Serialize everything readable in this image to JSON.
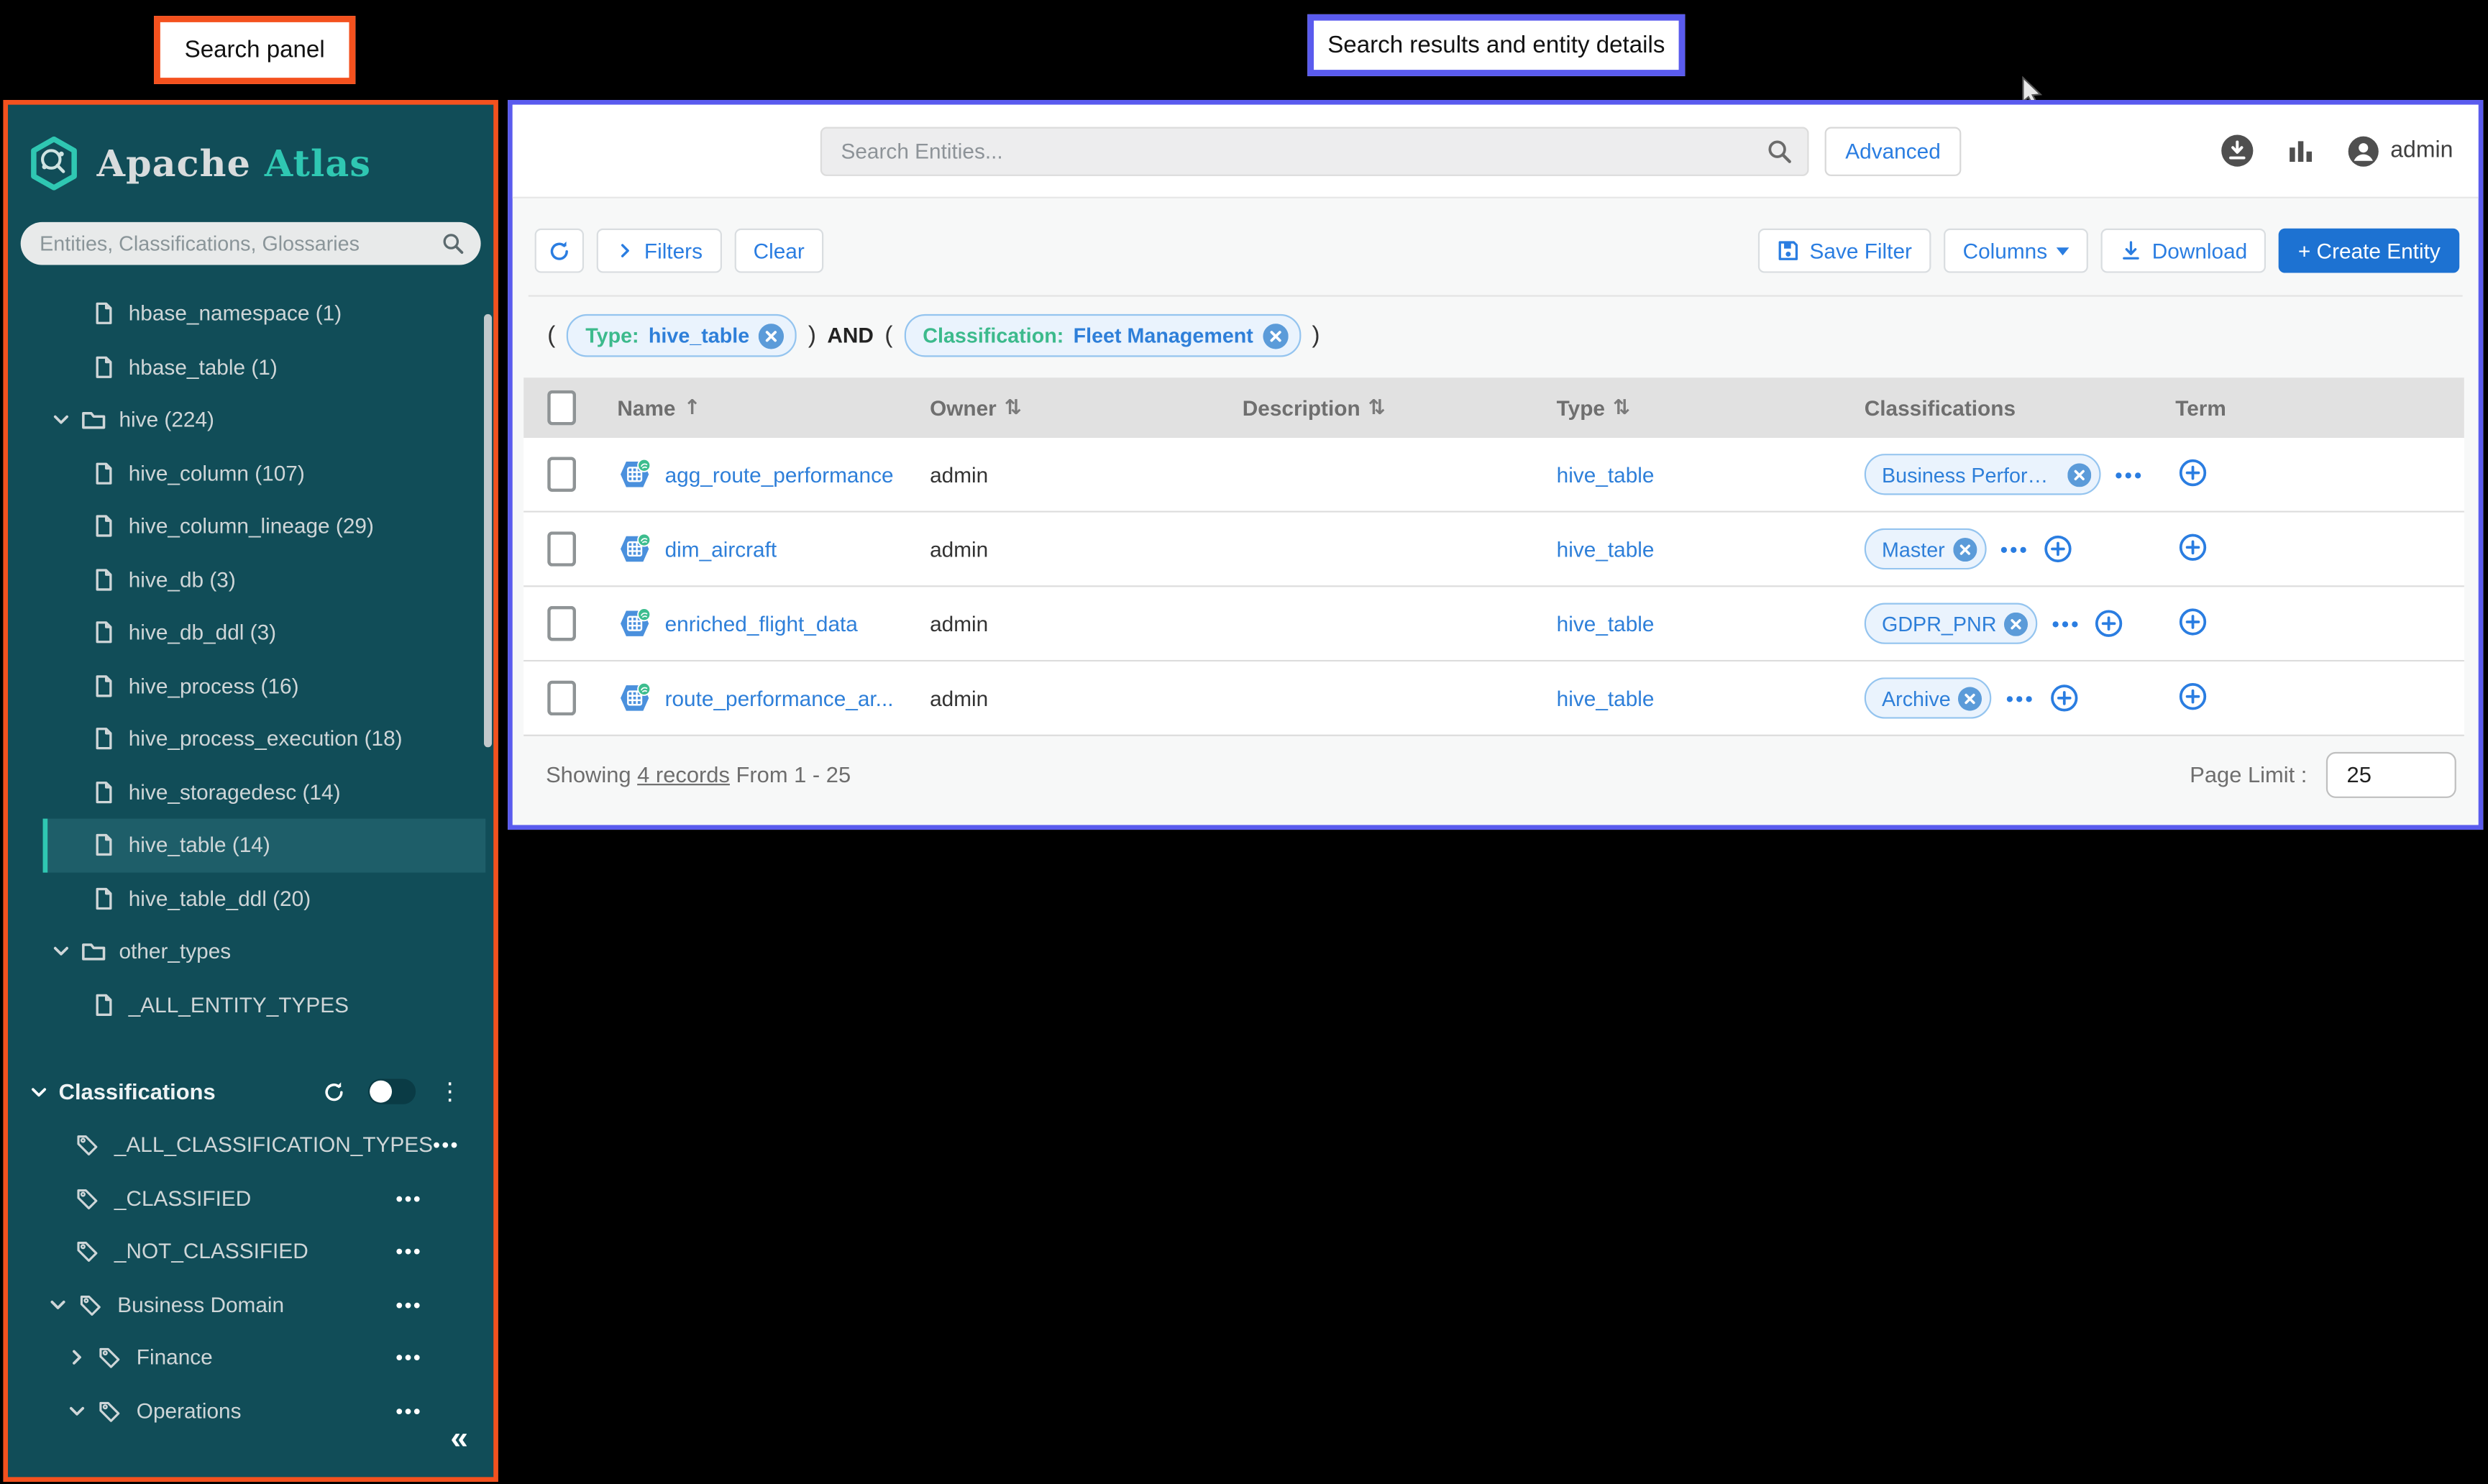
{
  "annotations": {
    "search_panel_label": "Search panel",
    "results_label": "Search results and entity details"
  },
  "sidebar": {
    "logo": {
      "title_primary": "Apache",
      "title_accent": "Atlas"
    },
    "search_placeholder": "Entities, Classifications, Glossaries",
    "entity_tree": [
      {
        "label": "hbase_namespace (1)",
        "icon": "doc"
      },
      {
        "label": "hbase_table (1)",
        "icon": "doc"
      },
      {
        "label": "hive (224)",
        "icon": "folder",
        "chevron": "down"
      },
      {
        "label": "hive_column (107)",
        "icon": "doc"
      },
      {
        "label": "hive_column_lineage (29)",
        "icon": "doc"
      },
      {
        "label": "hive_db (3)",
        "icon": "doc"
      },
      {
        "label": "hive_db_ddl (3)",
        "icon": "doc"
      },
      {
        "label": "hive_process (16)",
        "icon": "doc"
      },
      {
        "label": "hive_process_execution (18)",
        "icon": "doc"
      },
      {
        "label": "hive_storagedesc (14)",
        "icon": "doc"
      },
      {
        "label": "hive_table (14)",
        "icon": "doc",
        "selected": true
      },
      {
        "label": "hive_table_ddl (20)",
        "icon": "doc"
      },
      {
        "label": "other_types",
        "icon": "folder",
        "chevron": "down"
      },
      {
        "label": "_ALL_ENTITY_TYPES",
        "icon": "doc"
      }
    ],
    "classifications": {
      "header": "Classifications",
      "items": [
        {
          "label": "_ALL_CLASSIFICATION_TYPES",
          "indent": 0,
          "chevron": null
        },
        {
          "label": "_CLASSIFIED",
          "indent": 0,
          "chevron": null
        },
        {
          "label": "_NOT_CLASSIFIED",
          "indent": 0,
          "chevron": null
        },
        {
          "label": "Business Domain",
          "indent": 0,
          "chevron": "down"
        },
        {
          "label": "Finance",
          "indent": 1,
          "chevron": "right"
        },
        {
          "label": "Operations",
          "indent": 1,
          "chevron": "down"
        }
      ]
    }
  },
  "topbar": {
    "search_placeholder": "Search Entities...",
    "advanced_label": "Advanced",
    "username": "admin"
  },
  "toolbar": {
    "filters_label": "Filters",
    "clear_label": "Clear",
    "save_filter_label": "Save Filter",
    "columns_label": "Columns",
    "download_label": "Download",
    "create_entity_label": "+ Create Entity"
  },
  "query": {
    "parts": [
      {
        "type": "text",
        "value": "("
      },
      {
        "type": "chip",
        "key": "Type:",
        "value": "hive_table"
      },
      {
        "type": "text",
        "value": ")"
      },
      {
        "type": "and",
        "value": "AND"
      },
      {
        "type": "text",
        "value": "("
      },
      {
        "type": "chip",
        "key": "Classification:",
        "value": "Fleet Management"
      },
      {
        "type": "text",
        "value": ")"
      }
    ]
  },
  "table": {
    "columns": [
      {
        "label": "Name",
        "sort": "asc"
      },
      {
        "label": "Owner",
        "sort": "both"
      },
      {
        "label": "Description",
        "sort": "both"
      },
      {
        "label": "Type",
        "sort": "both"
      },
      {
        "label": "Classifications",
        "sort": null
      },
      {
        "label": "Term",
        "sort": null
      }
    ],
    "rows": [
      {
        "name": "agg_route_performance",
        "owner": "admin",
        "description": "",
        "type": "hive_table",
        "classification": "Business Performa...",
        "add_classification_button": false
      },
      {
        "name": "dim_aircraft",
        "owner": "admin",
        "description": "",
        "type": "hive_table",
        "classification": "Master",
        "add_classification_button": true
      },
      {
        "name": "enriched_flight_data",
        "owner": "admin",
        "description": "",
        "type": "hive_table",
        "classification": "GDPR_PNR",
        "add_classification_button": true
      },
      {
        "name": "route_performance_ar...",
        "owner": "admin",
        "description": "",
        "type": "hive_table",
        "classification": "Archive",
        "add_classification_button": true
      }
    ]
  },
  "footer": {
    "showing_prefix": "Showing",
    "records_link": "4 records",
    "showing_suffix": "From 1 - 25",
    "page_limit_label": "Page Limit :",
    "page_limit_value": "25"
  },
  "colors": {
    "sidebar_teal": "#114d58",
    "atlas_teal": "#2fc7b2",
    "accent_blue": "#1d72d2",
    "chip_green": "#3cba8c",
    "annotation_orange": "#f4511e",
    "annotation_purple": "#5a5bee"
  }
}
